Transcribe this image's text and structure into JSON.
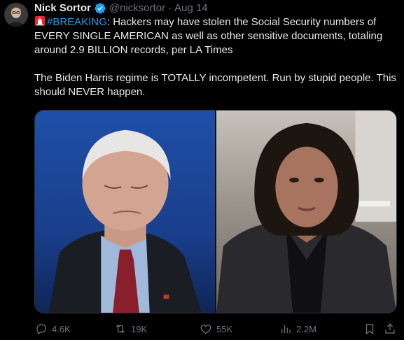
{
  "author": {
    "name": "Nick Sortor",
    "handle": "@nicksortor",
    "separator": "·",
    "date": "Aug 14",
    "verified": true
  },
  "tweet": {
    "hashtag": "#BREAKING",
    "paragraph1_rest": ": Hackers may have stolen the Social Security numbers of EVERY SINGLE AMERICAN as well as other sensitive documents, totaling around 2.9 BILLION records, per LA Times",
    "paragraph2": "The Biden Harris regime is TOTALLY incompetent. Run by stupid people. This should NEVER happen."
  },
  "media": {
    "images": [
      "left-portrait-image",
      "right-portrait-image"
    ]
  },
  "actions": {
    "replies": "4.6K",
    "retweets": "19K",
    "likes": "55K",
    "views": "2.2M"
  },
  "colors": {
    "background": "#000000",
    "text": "#e7e9ea",
    "muted": "#71767b",
    "accent": "#1d9bf0",
    "siren": "#f4212e"
  },
  "icons": [
    "siren-icon",
    "verified-badge-icon",
    "reply-icon",
    "retweet-icon",
    "like-icon",
    "views-icon",
    "bookmark-icon",
    "share-icon"
  ]
}
